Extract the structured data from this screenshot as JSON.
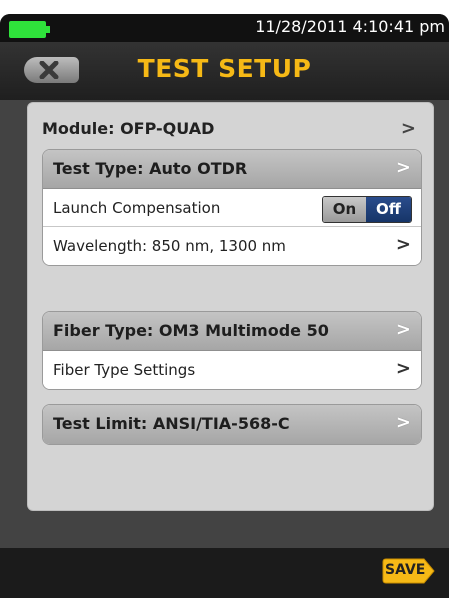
{
  "status_bar": {
    "clock": "11/28/2011 4:10:41 pm"
  },
  "header": {
    "title": "TEST SETUP"
  },
  "module": {
    "label": "Module: OFP-QUAD"
  },
  "groups": [
    {
      "header": "Test Type: Auto OTDR",
      "rows": [
        {
          "label": "Launch Compensation",
          "toggle": {
            "on_label": "On",
            "off_label": "Off",
            "selected": "Off"
          }
        },
        {
          "label": "Wavelength: 850 nm, 1300 nm"
        }
      ]
    },
    {
      "header": "Fiber Type: OM3 Multimode 50",
      "rows": [
        {
          "label": "Fiber Type Settings"
        }
      ]
    },
    {
      "header": "Test Limit: ANSI/TIA-568-C",
      "rows": []
    }
  ],
  "footer": {
    "save_label": "SAVE"
  },
  "colors": {
    "accent": "#f6b916",
    "toggle_selected": "#1e3f7a",
    "battery": "#2fe23b"
  }
}
